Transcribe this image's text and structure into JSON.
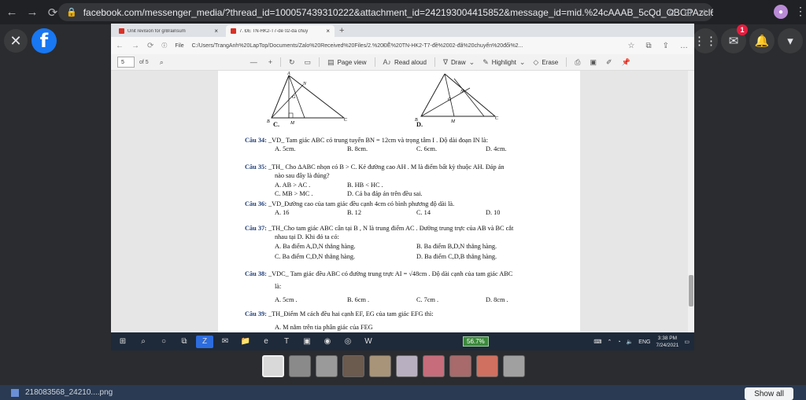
{
  "browser": {
    "url": "facebook.com/messenger_media/?thread_id=100057439310222&attachment_id=242193004415852&message_id=mid.%24cAAAB_5cQd_OBCPAzcl616rhKztTM",
    "notification_count": "1"
  },
  "inner_browser": {
    "tabs": [
      {
        "title": "Unit revision for g/Brainsum"
      },
      {
        "title": "7. ĐỀ TN-HK2-T7-đề 02-đã chuy"
      }
    ],
    "file_label": "File",
    "path": "C:/Users/TrangAnh%20LapTop/Documents/Zalo%20Received%20Files/2.%20ĐỀ%20TN-HK2-T7-đề%2002-đã%20chuyển%20đổi%2..."
  },
  "pdf_toolbar": {
    "page_current": "5",
    "page_total": "of 5",
    "page_view": "Page view",
    "read_aloud": "Read aloud",
    "draw": "Draw",
    "highlight": "Highlight",
    "erase": "Erase"
  },
  "document": {
    "fig_labels": {
      "c": "C.",
      "d": "D."
    },
    "q34": {
      "label": "Câu 34:",
      "text": "_VD_ Tam giác ABC có trung tuyến BN = 12cm và trọng tâm I . Độ dài đoạn IN là:",
      "options": [
        "A. 5cm.",
        "B. 8cm.",
        "C. 6cm.",
        "D. 4cm."
      ]
    },
    "q35": {
      "label": "Câu 35:",
      "text": "_TH_ Cho ΔABC nhọn có B > C. Kẻ đường cao AH . M là điểm bất kỳ thuộc AH. Đáp án",
      "text2": "nào sau đây là đúng?",
      "options": [
        "A. AB > AC .",
        "B. HB < HC .",
        "C. MB > MC .",
        "D. Cả ba đáp án trên đều sai."
      ]
    },
    "q36": {
      "label": "Câu 36:",
      "text": "_VD_Đường cao của tam giác đều cạnh 4cm có bình phương độ dài là.",
      "options": [
        "A. 16",
        "B. 12",
        "C. 14",
        "D. 10"
      ]
    },
    "q37": {
      "label": "Câu 37:",
      "text": "_TH_Cho tam giác ABC cân tại B , N là trung điểm AC . Đường trung trực của AB và BC cắt",
      "text2": "nhau tại D. Khi đó ta có:",
      "options": [
        "A. Ba điểm A,D,N thẳng hàng.",
        "B. Ba điểm B,D,N thẳng hàng.",
        "C. Ba điểm C,D,N thẳng hàng.",
        "D. Ba điểm C,D,B thẳng hàng."
      ]
    },
    "q38": {
      "label": "Câu 38:",
      "text": "_VDC_ Tam giác đều ABC có đường trung trực AI = √48cm . Độ dài cạnh của tam giác ABC",
      "text2": "là:",
      "options": [
        "A. 5cm .",
        "B. 6cm .",
        "C. 7cm .",
        "D. 8cm ."
      ]
    },
    "q39": {
      "label": "Câu 39:",
      "text": "_TH_Điểm M cách đều hai cạnh EF, EG của tam giác EFG thì:",
      "options": [
        "A. M nằm trên tia phân giác của FEG"
      ]
    }
  },
  "taskbar": {
    "battery": "56.7%",
    "lang": "ENG",
    "time": "3:38 PM",
    "date": "7/24/2021"
  },
  "download": {
    "filename": "218083568_24210....png",
    "show_all": "Show all"
  }
}
